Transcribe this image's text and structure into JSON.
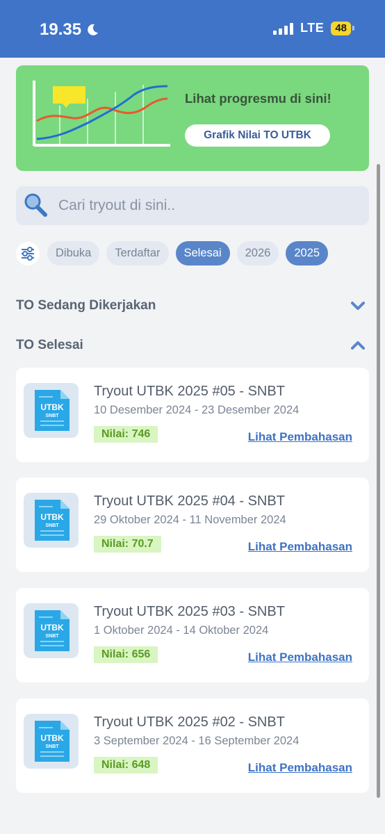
{
  "status_bar": {
    "time": "19.35",
    "network": "LTE",
    "battery": "48"
  },
  "promo": {
    "title": "Lihat progresmu di sini!",
    "button_label": "Grafik Nilai TO UTBK"
  },
  "search": {
    "placeholder": "Cari tryout di sini.."
  },
  "filters": [
    {
      "label": "Dibuka",
      "active": false
    },
    {
      "label": "Terdaftar",
      "active": false
    },
    {
      "label": "Selesai",
      "active": true
    },
    {
      "label": "2026",
      "active": false
    },
    {
      "label": "2025",
      "active": true
    }
  ],
  "sections": {
    "in_progress": {
      "title": "TO Sedang Dikerjakan",
      "expanded": false
    },
    "finished": {
      "title": "TO Selesai",
      "expanded": true
    }
  },
  "thumb": {
    "label": "UTBK",
    "sublabel": "SNBT"
  },
  "tryouts": [
    {
      "title": "Tryout UTBK 2025 #05 - SNBT",
      "dates": "10 Desember 2024 - 23 Desember 2024",
      "score": "Nilai: 746",
      "link": "Lihat Pembahasan"
    },
    {
      "title": "Tryout UTBK 2025 #04 - SNBT",
      "dates": "29 Oktober 2024 - 11 November 2024",
      "score": "Nilai: 70.7",
      "link": "Lihat Pembahasan"
    },
    {
      "title": "Tryout UTBK 2025 #03 - SNBT",
      "dates": "1 Oktober 2024 - 14 Oktober 2024",
      "score": "Nilai: 656",
      "link": "Lihat Pembahasan"
    },
    {
      "title": "Tryout UTBK 2025 #02 - SNBT",
      "dates": "3 September 2024 - 16 September 2024",
      "score": "Nilai: 648",
      "link": "Lihat Pembahasan"
    }
  ],
  "colors": {
    "status_bar": "#3f74c9",
    "promo_bg": "#7ad87f",
    "chip_active": "#5a86c9",
    "link": "#3d72c4",
    "score_bg": "#d9f5c2"
  }
}
